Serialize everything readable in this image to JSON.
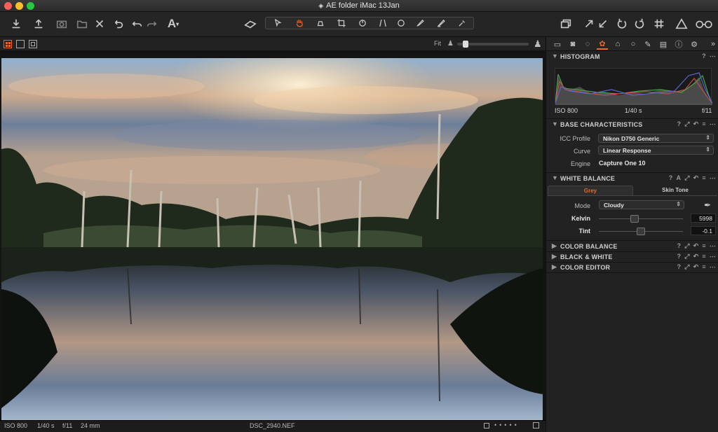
{
  "window": {
    "title": "AE folder iMac 13Jan"
  },
  "colors": {
    "accent": "#e8692c",
    "close": "#fc5f57",
    "minimize": "#fdbc2e",
    "zoom": "#28c840"
  },
  "toolbar": {
    "left_icons": [
      "import-icon",
      "export-icon",
      "camera-icon",
      "folder-tag-icon",
      "delete-icon",
      "rotate-undo-icon",
      "undo-icon",
      "redo-icon",
      "text-icon"
    ],
    "cursor_tools": [
      "select-icon",
      "hand-icon",
      "loupe-icon",
      "crop-icon",
      "rotate-icon",
      "keystone-icon",
      "spot-icon",
      "brush-icon",
      "eraser-icon",
      "picker-icon"
    ],
    "right_icons": [
      "layers-icon",
      "expand-icon",
      "collapse-icon",
      "rotate-left-icon",
      "rotate-right-icon",
      "grid-icon",
      "warning-icon",
      "glasses-icon"
    ]
  },
  "subbar": {
    "fit_label": "Fit"
  },
  "statusbar": {
    "iso": "ISO 800",
    "shutter": "1/40 s",
    "aperture": "f/11",
    "focal": "24 mm",
    "filename": "DSC_2940.NEF"
  },
  "panel": {
    "histogram": {
      "title": "HISTOGRAM",
      "help": "?",
      "iso": "ISO 800",
      "shutter": "1/40 s",
      "aperture": "f/11"
    },
    "base": {
      "title": "BASE CHARACTERISTICS",
      "icc_label": "ICC Profile",
      "icc_value": "Nikon D750 Generic",
      "curve_label": "Curve",
      "curve_value": "Linear Response",
      "engine_label": "Engine",
      "engine_value": "Capture One 10"
    },
    "wb": {
      "title": "WHITE BALANCE",
      "tab_grey": "Grey",
      "tab_skin": "Skin Tone",
      "mode_label": "Mode",
      "mode_value": "Cloudy",
      "kelvin_label": "Kelvin",
      "kelvin_value": "5998",
      "tint_label": "Tint",
      "tint_value": "-0.1",
      "kelvin_level": 0.42,
      "tint_level": 0.5
    },
    "collapsed": [
      {
        "title": "COLOR BALANCE"
      },
      {
        "title": "BLACK & WHITE"
      },
      {
        "title": "COLOR EDITOR"
      }
    ]
  }
}
